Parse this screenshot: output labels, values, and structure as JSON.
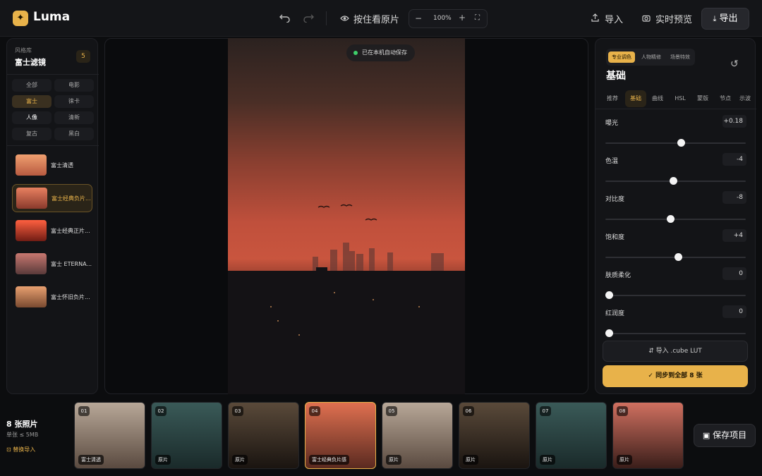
{
  "app": {
    "name": "Luma"
  },
  "toolbar": {
    "undo_icon": "undo-icon",
    "redo_icon": "redo-icon",
    "hold_original": "按住看原片",
    "zoom_minus": "−",
    "zoom_level": "100%",
    "zoom_plus": "+",
    "fit_icon": "fit-screen-icon",
    "import": "导入",
    "live_preview": "实时预览",
    "export": "导出"
  },
  "library": {
    "subtitle": "风格库",
    "title": "富士滤镜",
    "count": "5",
    "chips": [
      "全部",
      "电影",
      "富士",
      "徕卡",
      "人像",
      "清新",
      "复古",
      "黑白"
    ],
    "filters": [
      {
        "name": "富士清透",
        "grad": "#f0a070,#b85a40"
      },
      {
        "name": "富士经典负片...",
        "grad": "#e88060,#8a3a2c"
      },
      {
        "name": "富士经典正片...",
        "grad": "#ff6040,#701c14"
      },
      {
        "name": "富士 ETERNA...",
        "grad": "#c87870,#5a3a3a"
      },
      {
        "name": "富士怀旧负片...",
        "grad": "#e8a070,#7a4a30"
      }
    ]
  },
  "canvas": {
    "saved_status": "已在本机自动保存"
  },
  "adjust": {
    "mode_tabs": [
      "专业调色",
      "人物精修",
      "场景特效"
    ],
    "section": "基础",
    "sub_tabs": [
      "推荐",
      "基础",
      "曲线",
      "HSL",
      "蒙版",
      "节点",
      "示波器"
    ],
    "sliders": [
      {
        "label": "曝光",
        "value": "+0.18",
        "pos": 0.54
      },
      {
        "label": "色温",
        "value": "-4",
        "pos": 0.48
      },
      {
        "label": "对比度",
        "value": "-8",
        "pos": 0.46
      },
      {
        "label": "饱和度",
        "value": "+4",
        "pos": 0.52
      },
      {
        "label": "肤质柔化",
        "value": "0",
        "pos": 0.0
      },
      {
        "label": "红润度",
        "value": "0",
        "pos": 0.0
      }
    ],
    "import_lut": "导入 .cube LUT",
    "sync_all": "同步到全部 8 张"
  },
  "filmstrip": {
    "count_label": "8 张照片",
    "limit": "单张 ≤ 5MB",
    "replace": "替换导入",
    "save_project": "保存项目",
    "photos": [
      {
        "num": "01",
        "tag": "富士清透",
        "grad": "#b8a898,#5a4a40"
      },
      {
        "num": "02",
        "tag": "原片",
        "grad": "#3a5a58,#1a2a2a"
      },
      {
        "num": "03",
        "tag": "原片",
        "grad": "#5a4a3a,#1a1410"
      },
      {
        "num": "04",
        "tag": "富士经典负片感",
        "grad": "#e07050,#5a2a20"
      },
      {
        "num": "05",
        "tag": "原片",
        "grad": "#b8a898,#5a4a40"
      },
      {
        "num": "06",
        "tag": "原片",
        "grad": "#5a4a3a,#1a1410"
      },
      {
        "num": "07",
        "tag": "原片",
        "grad": "#3a5a58,#1a2a2a"
      },
      {
        "num": "08",
        "tag": "原片",
        "grad": "#d07060,#3a1e1a"
      }
    ]
  }
}
